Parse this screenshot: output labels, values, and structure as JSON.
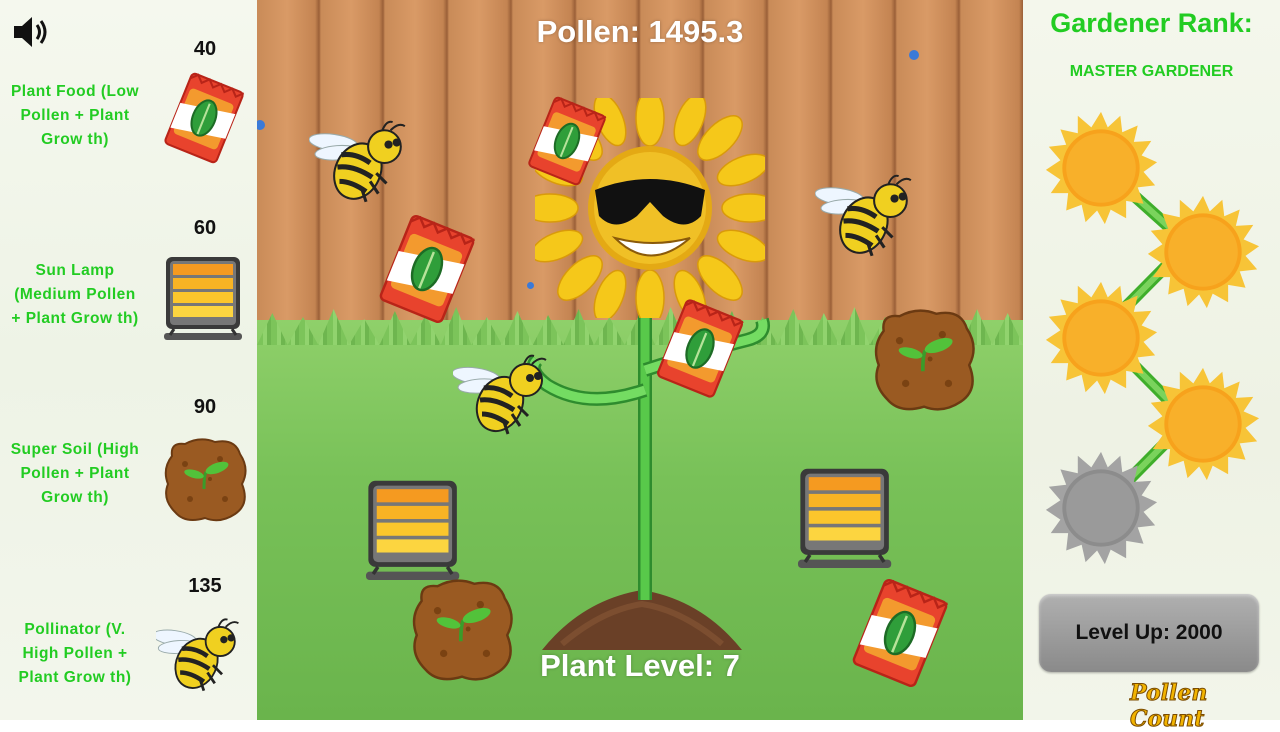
{
  "hud": {
    "pollen": "Pollen: 1495.3",
    "plant_level": "Plant Level: 7"
  },
  "shop": {
    "items": [
      {
        "price": "40",
        "label_lines": [
          "Plant Food (Low",
          "Pollen + Plant",
          "Grow th)"
        ],
        "icon": "plant-food-bag-icon"
      },
      {
        "price": "60",
        "label_lines": [
          "Sun Lamp",
          "(Medium Pollen",
          "+ Plant Grow th)"
        ],
        "icon": "sun-lamp-icon"
      },
      {
        "price": "90",
        "label_lines": [
          "Super Soil (High",
          "Pollen + Plant",
          "Grow th)"
        ],
        "icon": "super-soil-icon"
      },
      {
        "price": "135",
        "label_lines": [
          "Pollinator (V.",
          "High Pollen +",
          "Plant Grow th)"
        ],
        "icon": "bee-icon"
      }
    ]
  },
  "rank": {
    "title": "Gardener Rank:",
    "name": "MASTER GARDENER",
    "suns": [
      {
        "state": "gold"
      },
      {
        "state": "gold"
      },
      {
        "state": "gold"
      },
      {
        "state": "gold"
      },
      {
        "state": "grey"
      }
    ]
  },
  "level_up": "Level Up: 2000",
  "logo": "Pollen Count",
  "colors": {
    "accent_green": "#22cc22",
    "pollen_text": "#ffffff",
    "sun_gold": "#f7a21c",
    "sun_grey": "#8c8c8c"
  },
  "icons": {
    "sound": "speaker-icon"
  }
}
